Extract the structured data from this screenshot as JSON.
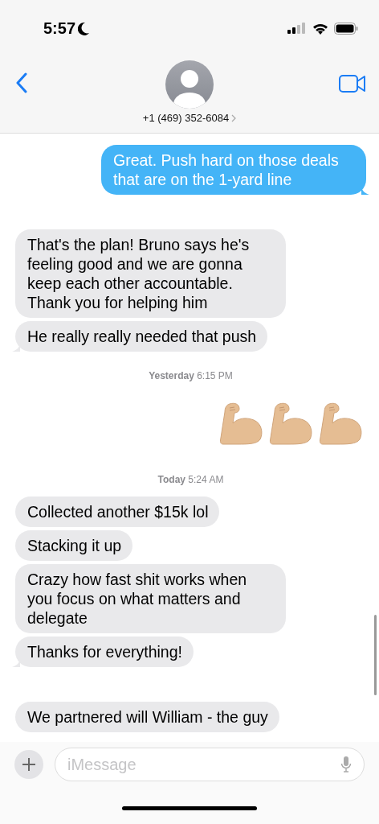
{
  "status_bar": {
    "time": "5:57"
  },
  "header": {
    "contact": "+1 (469) 352-6084"
  },
  "messages": [
    {
      "kind": "sent",
      "text": "Great. Push hard on those deals that are on the 1-yard line",
      "tail": true
    },
    {
      "kind": "received",
      "text": "That's the plan! Bruno says he's feeling good and we are gonna keep each other accountable. Thank you for helping him",
      "tail": false
    },
    {
      "kind": "received",
      "text": "He really really needed that push",
      "tail": true
    },
    {
      "kind": "timestamp",
      "day": "Yesterday",
      "time": "6:15 PM"
    },
    {
      "kind": "emoji",
      "emojis": [
        {
          "kind": "flexed-biceps"
        },
        {
          "kind": "flexed-biceps"
        },
        {
          "kind": "flexed-biceps"
        }
      ]
    },
    {
      "kind": "timestamp",
      "day": "Today",
      "time": "5:24 AM"
    },
    {
      "kind": "received",
      "text": "Collected another $15k lol",
      "tail": false
    },
    {
      "kind": "received",
      "text": "Stacking it up",
      "tail": false
    },
    {
      "kind": "received",
      "text": "Crazy how fast shit works when you focus on what matters and delegate",
      "tail": false
    },
    {
      "kind": "received",
      "text": "Thanks for everything!",
      "tail": true
    },
    {
      "kind": "received",
      "text": "We partnered will William - the guy",
      "tail": false
    }
  ],
  "composer": {
    "placeholder": "iMessage"
  }
}
